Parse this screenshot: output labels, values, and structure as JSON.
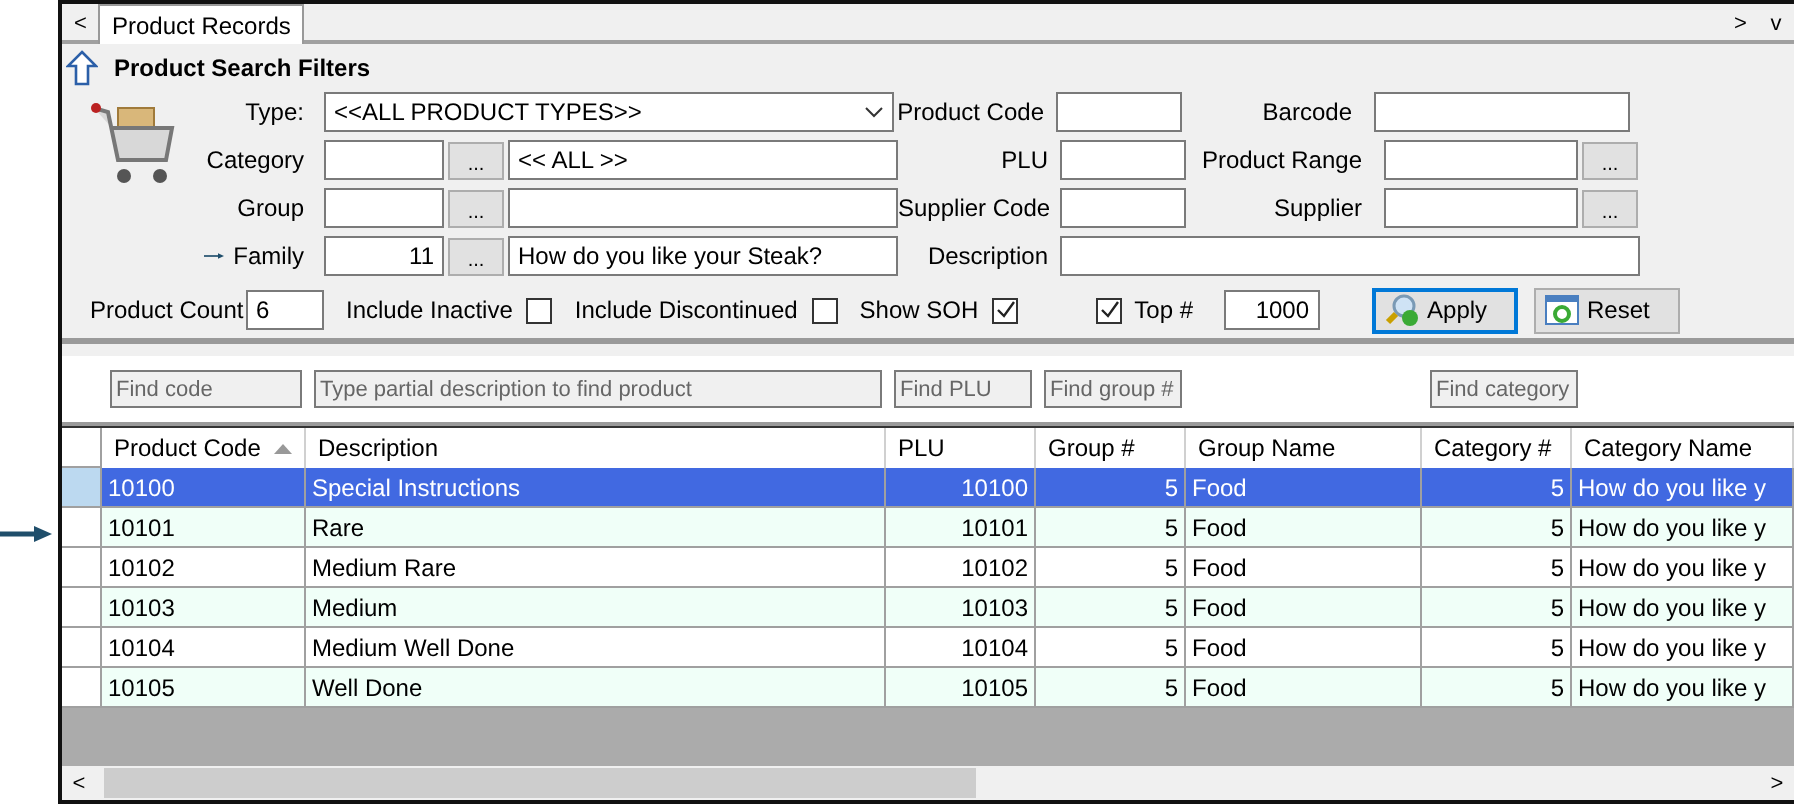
{
  "tab_bar": {
    "left_scroll": "<",
    "tabs": [
      {
        "label": "Product Records",
        "selected": true
      }
    ],
    "right_controls": [
      ">",
      "v"
    ]
  },
  "filter_panel": {
    "title": "Product Search Filters",
    "type": {
      "label": "Type:",
      "value": "<<ALL PRODUCT TYPES>>"
    },
    "lookups": [
      {
        "label": "Category",
        "browse": "...",
        "name": "<< ALL >>",
        "pointer": false
      },
      {
        "label": "Group",
        "browse": "...",
        "pointer": false
      },
      {
        "label": "Family",
        "code": "11",
        "browse": "...",
        "name": "How do you like your Steak?",
        "pointer": true
      }
    ],
    "middle_fields": [
      {
        "label": "Product Code"
      },
      {
        "label": "PLU"
      },
      {
        "label": "Supplier Code"
      },
      {
        "label": "Description"
      }
    ],
    "right_fields": [
      {
        "label": "Barcode"
      },
      {
        "label": "Product Range",
        "browse": "..."
      },
      {
        "label": "Supplier",
        "browse": "..."
      }
    ],
    "product_count": {
      "label": "Product Count",
      "value": "6"
    },
    "options": [
      {
        "label": "Include Inactive",
        "checked": false
      },
      {
        "label": "Include Discontinued",
        "checked": false
      },
      {
        "label": "Show SOH",
        "checked": true
      }
    ],
    "top": {
      "checked": true,
      "label": "Top #",
      "value": "1000"
    },
    "buttons": [
      {
        "kind": "apply",
        "label": "Apply",
        "focused": true
      },
      {
        "kind": "reset",
        "label": "Reset",
        "focused": false
      }
    ]
  },
  "grid": {
    "columns": [
      {
        "label": "Product Code",
        "sorted": true,
        "numeric": false,
        "placeholder": "Find code"
      },
      {
        "label": "Description",
        "sorted": false,
        "numeric": false,
        "placeholder": "Type partial description to find product"
      },
      {
        "label": "PLU",
        "sorted": false,
        "numeric": true,
        "placeholder": "Find PLU"
      },
      {
        "label": "Group #",
        "sorted": false,
        "numeric": true,
        "placeholder": "Find group #"
      },
      {
        "label": "Group Name",
        "sorted": false,
        "numeric": false
      },
      {
        "label": "Category #",
        "sorted": false,
        "numeric": true,
        "placeholder": "Find category"
      },
      {
        "label": "Category Name",
        "sorted": false,
        "numeric": false
      }
    ],
    "rows": [
      {
        "selected": true,
        "pointer": false,
        "cells": [
          "10100",
          "Special Instructions",
          "10100",
          "5",
          "Food",
          "5",
          "How do you like y"
        ]
      },
      {
        "selected": false,
        "pointer": true,
        "cells": [
          "10101",
          "Rare",
          "10101",
          "5",
          "Food",
          "5",
          "How do you like y"
        ]
      },
      {
        "selected": false,
        "pointer": false,
        "cells": [
          "10102",
          "Medium Rare",
          "10102",
          "5",
          "Food",
          "5",
          "How do you like y"
        ]
      },
      {
        "selected": false,
        "pointer": false,
        "cells": [
          "10103",
          "Medium",
          "10103",
          "5",
          "Food",
          "5",
          "How do you like y"
        ]
      },
      {
        "selected": false,
        "pointer": false,
        "cells": [
          "10104",
          "Medium Well Done",
          "10104",
          "5",
          "Food",
          "5",
          "How do you like y"
        ]
      },
      {
        "selected": false,
        "pointer": false,
        "cells": [
          "10105",
          "Well Done",
          "10105",
          "5",
          "Food",
          "5",
          "How do you like y"
        ]
      }
    ],
    "scroll_left": "<",
    "scroll_right": ">"
  }
}
